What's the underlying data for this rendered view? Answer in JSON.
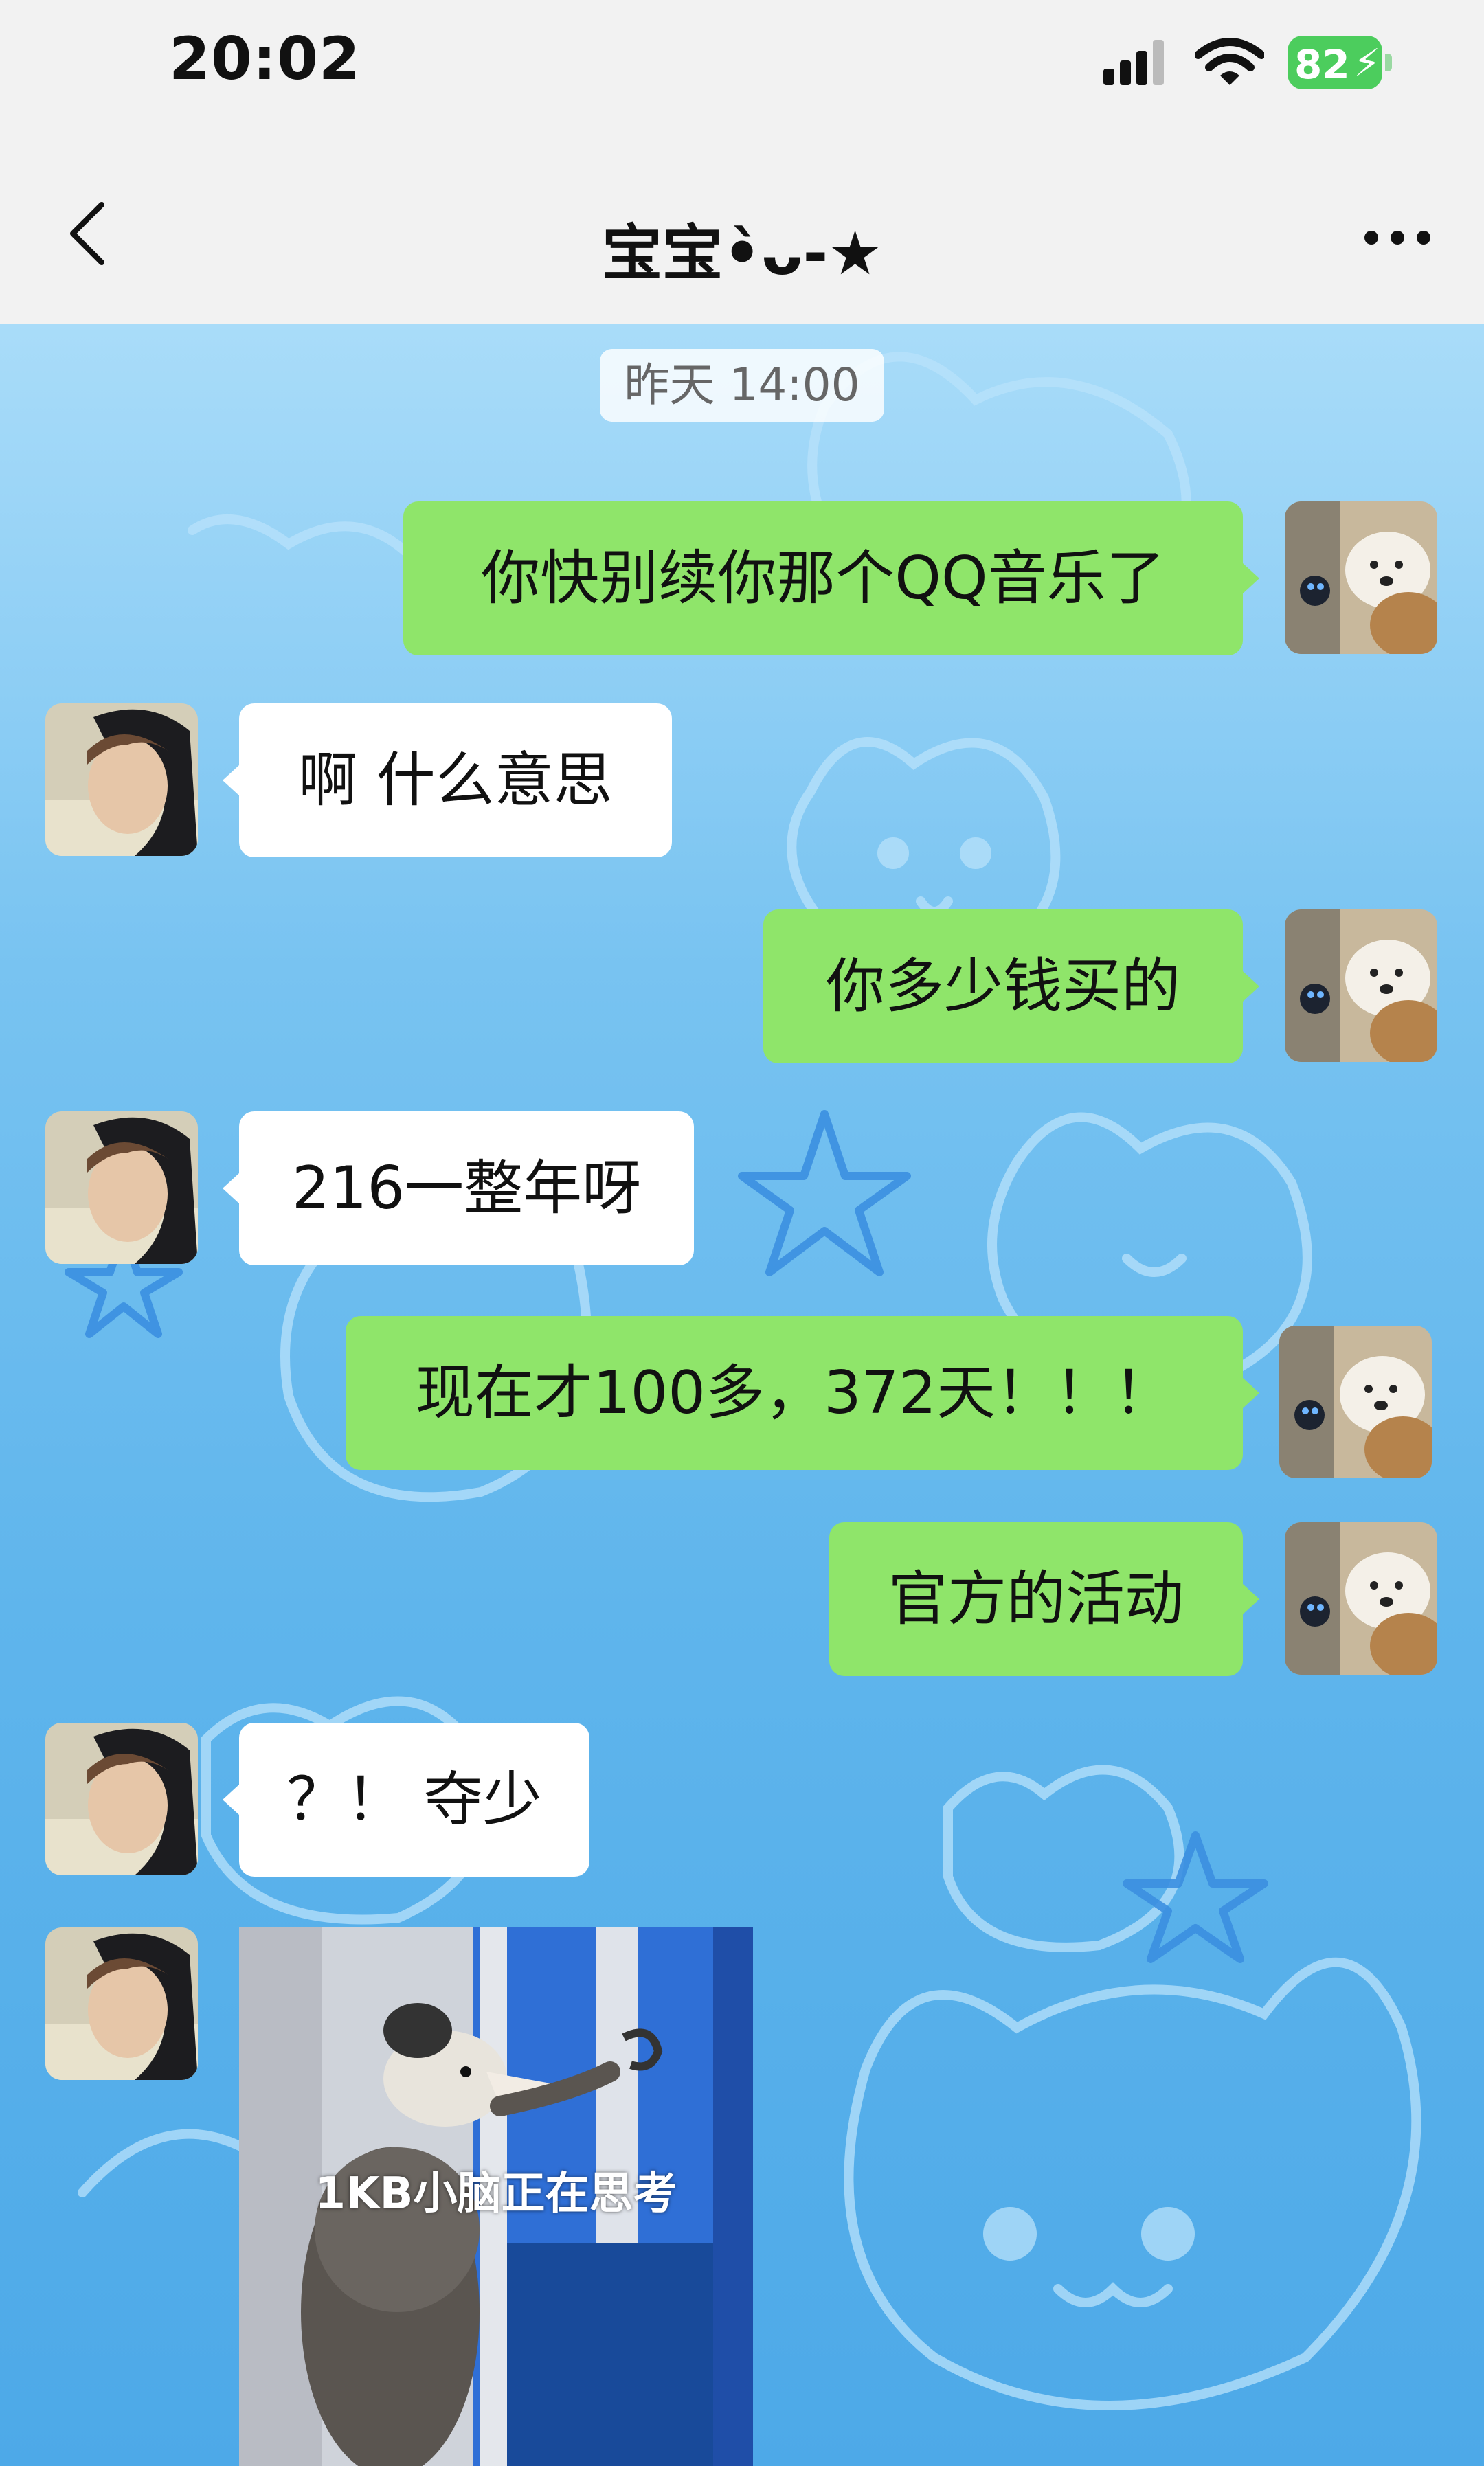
{
  "status_bar": {
    "time": "20:02",
    "battery": "82"
  },
  "nav": {
    "title": "宝宝•̀ᴗ-★"
  },
  "chat": {
    "timestamp": "昨天 14:00",
    "messages": [
      {
        "side": "me",
        "text": "你快别续你那个QQ音乐了"
      },
      {
        "side": "other",
        "text": "啊 什么意思"
      },
      {
        "side": "me",
        "text": "你多少钱买的"
      },
      {
        "side": "other",
        "text": "216一整年呀"
      },
      {
        "side": "me",
        "text": "现在才100多，372天！！！"
      },
      {
        "side": "me",
        "text": "官方的活动"
      },
      {
        "side": "other",
        "text": "？！ 夺少"
      }
    ],
    "image_message": {
      "caption": "1KB小脑正在思考"
    }
  },
  "colors": {
    "my_bubble": "#8fe56a",
    "other_bubble": "#ffffff",
    "battery": "#4ccd5d"
  },
  "icons": {
    "back": "chevron-left-icon",
    "more": "more-horizontal-icon",
    "signal": "cellular-signal-icon",
    "wifi": "wifi-icon",
    "battery": "battery-icon"
  }
}
